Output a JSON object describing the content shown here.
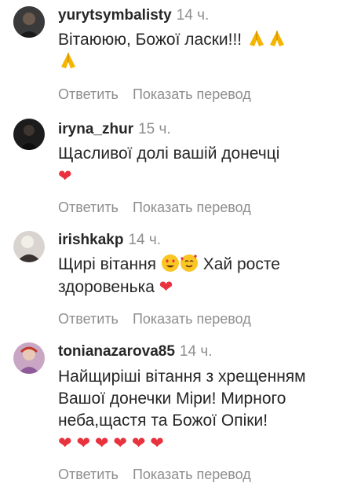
{
  "comments": [
    {
      "username": "yurytsymbalisty",
      "time": "14 ч.",
      "text": "Вітаююю, Божої ласки!!!",
      "reply": "Ответить",
      "translate": "Показать перевод"
    },
    {
      "username": "iryna_zhur",
      "time": "15 ч.",
      "text": "Щасливої долі вашій донечці",
      "reply": "Ответить",
      "translate": "Показать перевод"
    },
    {
      "username": "irishkakp",
      "time": "14 ч.",
      "text_a": "Щирі вітання",
      "text_b": "Хай росте",
      "text_c": "здоровенька",
      "reply": "Ответить",
      "translate": "Показать перевод"
    },
    {
      "username": "tonianazarova85",
      "time": "14 ч.",
      "text": "Найщиріші вітання з хрещенням Вашої  донечки Міри! Мирного неба,щастя та Божої Опіки!",
      "reply": "Ответить",
      "translate": "Показать перевод"
    }
  ],
  "icons": {
    "pray": "folded-hands-emoji",
    "heart": "red-heart-emoji",
    "heart_eyes": "smiling-face-with-heart-eyes-emoji",
    "hearts_face": "smiling-face-with-hearts-emoji"
  },
  "colors": {
    "text": "#262626",
    "secondary": "#8e8e8e",
    "heart": "#e8323d"
  }
}
